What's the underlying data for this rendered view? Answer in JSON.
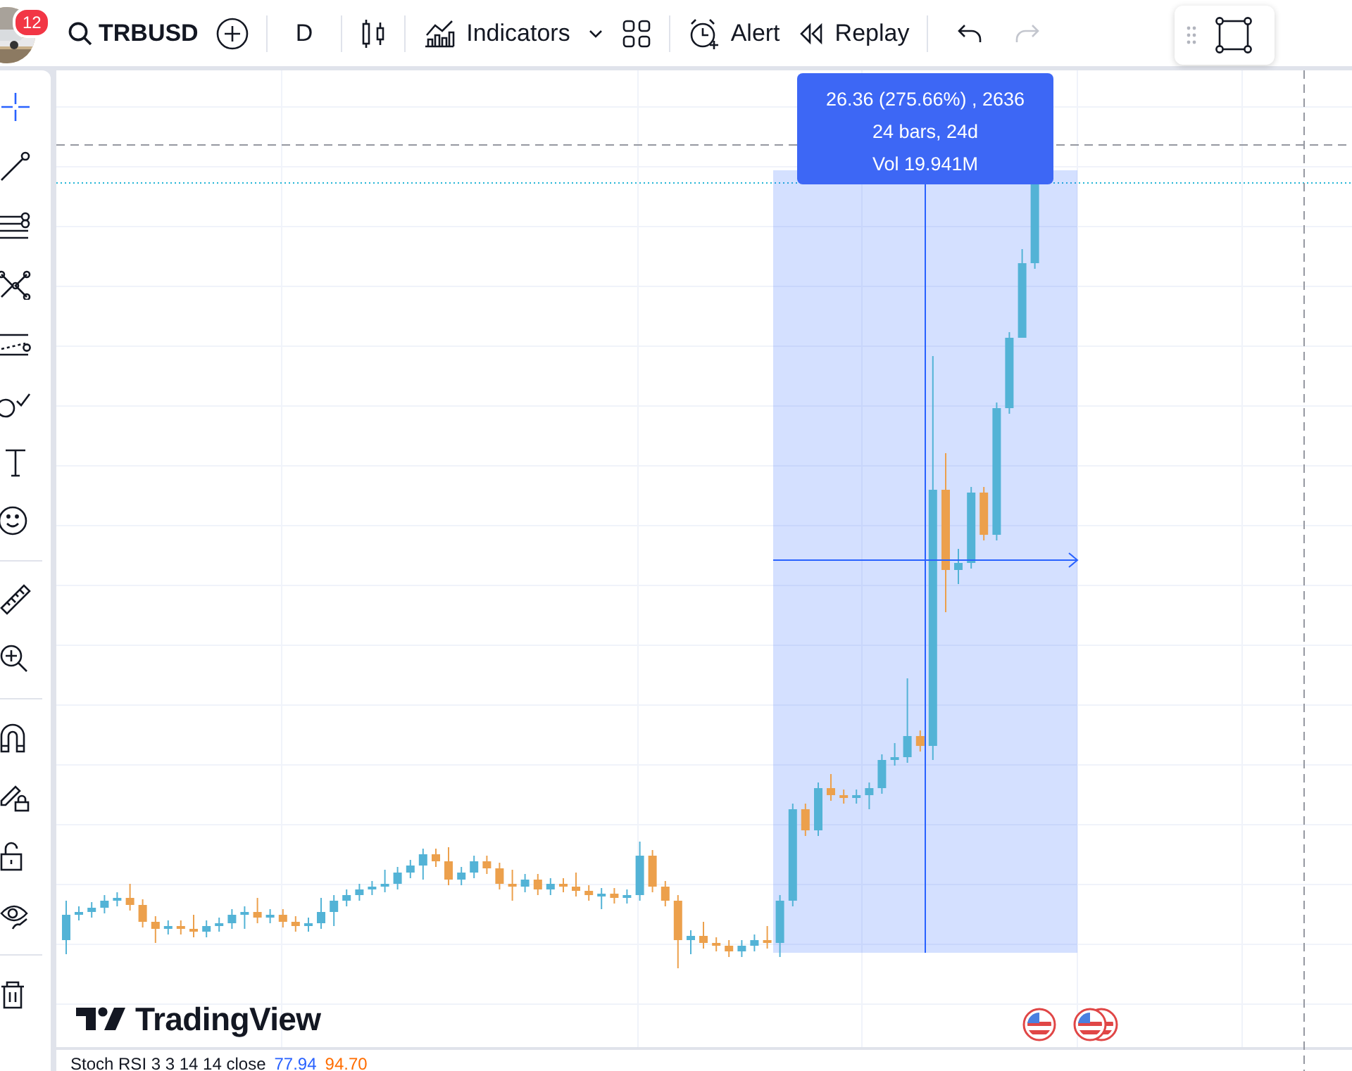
{
  "header": {
    "notification_count": "12",
    "symbol": "TRBUSD",
    "interval": "D",
    "indicators": "Indicators",
    "alert": "Alert",
    "replay": "Replay",
    "undo": {
      "disabled": false
    },
    "redo": {
      "disabled": true
    }
  },
  "drawing_tool_groups": [
    {
      "tools": [
        {
          "kind": "crosshair",
          "selected": true
        },
        {
          "kind": "trend-line",
          "selected": false
        },
        {
          "kind": "fib",
          "selected": false
        },
        {
          "kind": "pattern",
          "selected": false
        },
        {
          "kind": "forecast",
          "selected": false
        },
        {
          "kind": "brush",
          "selected": false
        },
        {
          "kind": "text",
          "selected": false
        },
        {
          "kind": "smiley",
          "selected": false
        }
      ]
    },
    {
      "tools": [
        {
          "kind": "ruler",
          "selected": false
        },
        {
          "kind": "zoom",
          "selected": false
        }
      ]
    },
    {
      "tools": [
        {
          "kind": "magnet",
          "selected": false
        },
        {
          "kind": "lock-drawing",
          "selected": false
        },
        {
          "kind": "lock",
          "selected": false
        },
        {
          "kind": "eye",
          "selected": false
        }
      ]
    },
    {
      "tools": [
        {
          "kind": "trash",
          "selected": false
        }
      ]
    }
  ],
  "measure": {
    "change": "26.36 (275.66%) , 2636",
    "bars": "24 bars, 24d",
    "volume": "Vol 19.941M"
  },
  "branding": "TradingView",
  "indicator_legend": {
    "name": "Stoch RSI 3 3 14 14 close",
    "values": [
      {
        "text": "77.94",
        "color": "#2962ff"
      },
      {
        "text": "94.70",
        "color": "#ff6d00"
      }
    ]
  }
}
